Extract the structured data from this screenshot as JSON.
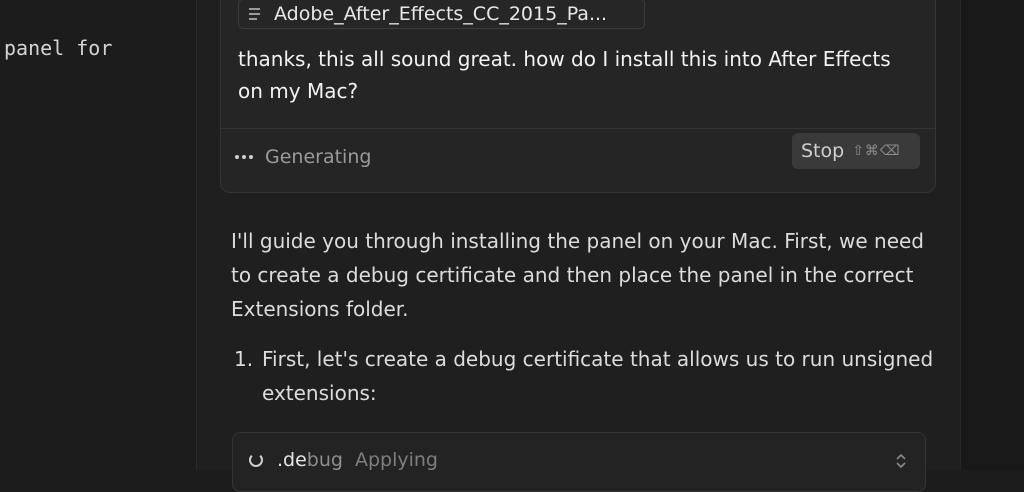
{
  "left_pane": {
    "code_fragment": "panel for"
  },
  "user_message": {
    "attachment_name": "Adobe_After_Effects_CC_2015_Pa...",
    "text": "thanks, this all sound great. how do I install this into After Effects on my Mac?",
    "status_label": "Generating",
    "stop_label": "Stop",
    "stop_shortcut": "⇧⌘⌫"
  },
  "assistant": {
    "intro": "I'll guide you through installing the panel on your Mac. First, we need to create a debug certificate and then place the panel in the correct Extensions folder.",
    "steps": [
      {
        "number": "1.",
        "text": "First, let's create a debug certificate that allows us to run unsigned extensions:"
      }
    ],
    "tool": {
      "file_prefix": ".de",
      "file_dim": "bug",
      "status": "Applying"
    }
  },
  "icons": {
    "attachment": "file-lines-icon",
    "status": "ellipsis-icon",
    "tool_status": "spinner-icon",
    "expand": "chevron-updown-icon"
  }
}
